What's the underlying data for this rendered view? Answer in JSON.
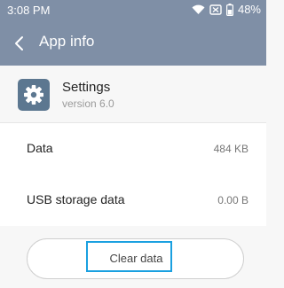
{
  "status_bar": {
    "time": "3:08 PM",
    "icons": [
      "wifi-icon",
      "sim-off-icon",
      "battery-icon"
    ],
    "battery": "48%"
  },
  "app_bar": {
    "title": "App info",
    "back_icon": "chevron-left-icon"
  },
  "app": {
    "name": "Settings",
    "version": "version 6.0",
    "icon": "gear-icon"
  },
  "storage": [
    {
      "label": "Data",
      "value": "484 KB"
    },
    {
      "label": "USB storage data",
      "value": "0.00 B"
    }
  ],
  "actions": {
    "clear_data_label": "Clear data"
  },
  "colors": {
    "header": "#7f8fa6",
    "app_icon": "#5c7790",
    "highlight": "#1aa0e0"
  }
}
